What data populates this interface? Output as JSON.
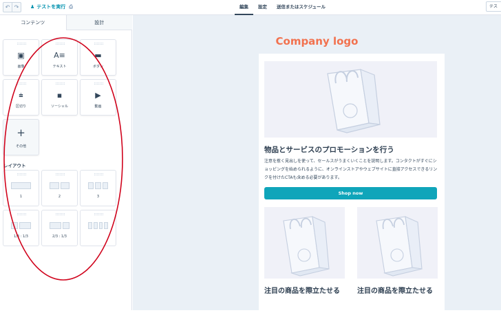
{
  "toolbar": {
    "undo_icon": "undo-icon",
    "redo_icon": "redo-icon",
    "undo_glyph": "↶",
    "redo_glyph": "↷",
    "test_run_label": "テストを実行",
    "tabs": [
      "編集",
      "設定",
      "送信またはスケジュール"
    ],
    "send_label": "テス"
  },
  "sidebar": {
    "tabs": [
      "コンテンツ",
      "設計"
    ],
    "modules": [
      {
        "label": "画像",
        "icon": "image-icon",
        "glyph": "▣"
      },
      {
        "label": "テキスト",
        "icon": "text-icon",
        "glyph": "A≡"
      },
      {
        "label": "ボタン",
        "icon": "button-icon",
        "glyph": "▬"
      },
      {
        "label": "区切り",
        "icon": "divider-icon",
        "glyph": "⩧"
      },
      {
        "label": "ソーシャル",
        "icon": "social-icon",
        "glyph": "▪"
      },
      {
        "label": "動画",
        "icon": "video-icon",
        "glyph": "▶"
      },
      {
        "label": "その他",
        "icon": "plus-icon",
        "glyph": "+"
      }
    ],
    "layout_title": "レイアウト",
    "layouts": [
      "1",
      "2",
      "3",
      "1/3 : 1/3",
      "2/3 : 1/3",
      ""
    ]
  },
  "preview": {
    "company_logo": "Company logo",
    "promo_title": "物品とサービスのプロモーションを行う",
    "promo_body": "注意を惹く見出しを使って、セールスがうまくいくことを説明します。コンタクトがすぐにショッピングを始められるように、オンラインストアやウェブサイトに直接アクセスできるリンクを付けたCTAも含める必要があります。",
    "shop_button": "Shop now",
    "sub_title_left": "注目の商品を際立たせる",
    "sub_title_right": "注目の商品を際立たせる"
  },
  "colors": {
    "accent_teal": "#0fa5ba",
    "logo_orange": "#f2724f",
    "annotation_red": "#d0021b",
    "canvas_bg": "#eaf0f6"
  }
}
